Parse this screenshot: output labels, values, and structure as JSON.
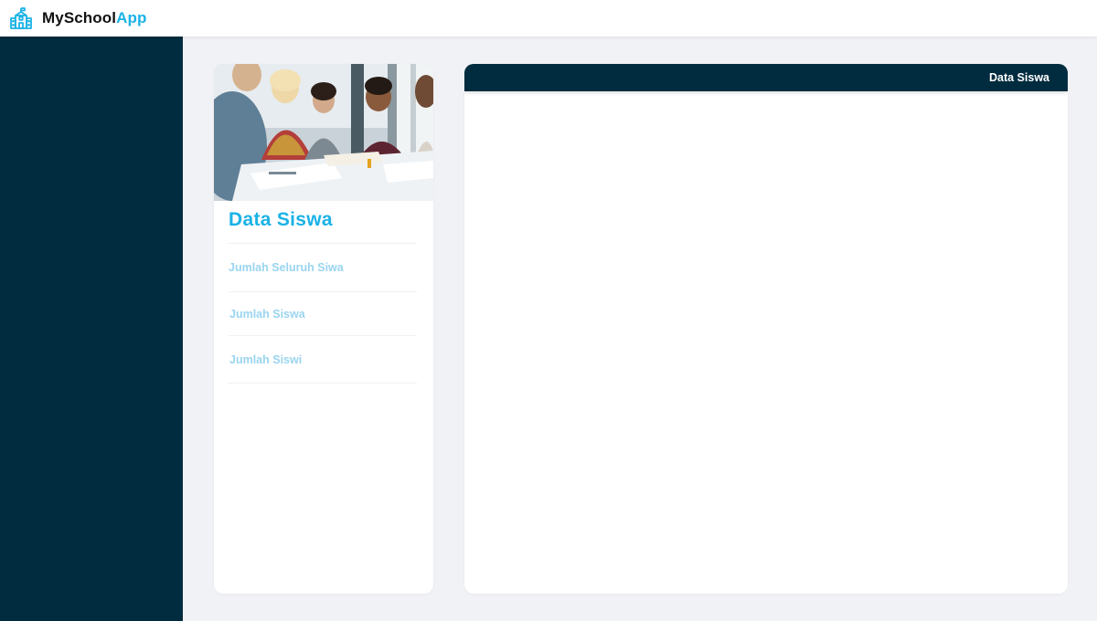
{
  "app": {
    "brand_primary": "MySchool",
    "brand_accent": "App",
    "logo_icon": "school-building-icon",
    "accent_color": "#1ab2e6",
    "dark_color": "#012c3f"
  },
  "left_card": {
    "image": "students-studying-photo",
    "title": "Data Siswa",
    "items": [
      {
        "label": "Jumlah Seluruh Siwa"
      },
      {
        "label": "Jumlah Siswa"
      },
      {
        "label": "Jumlah Siswi"
      }
    ]
  },
  "right_card": {
    "header_title": "Data Siswa"
  }
}
